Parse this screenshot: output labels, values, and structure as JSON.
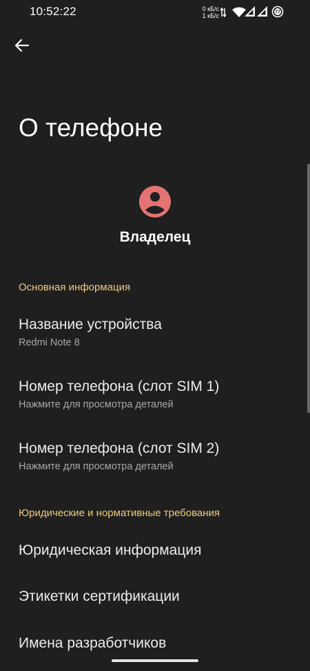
{
  "status_bar": {
    "time": "10:52:22",
    "net_speed_up": "0 кБ/с",
    "net_speed_down": "1 кБ/с",
    "battery_level": "77",
    "icons": [
      "data-transfer-icon",
      "wifi-icon",
      "signal-sim1-icon",
      "signal-sim2-icon",
      "battery-icon"
    ]
  },
  "header": {
    "back_icon": "arrow-left-icon",
    "title": "О телефоне"
  },
  "profile": {
    "avatar_icon": "account-circle-icon",
    "name": "Владелец",
    "avatar_color": "#e57373"
  },
  "sections": {
    "basic": {
      "title": "Основная информация",
      "items": [
        {
          "title": "Название устройства",
          "summary": "Redmi Note 8"
        },
        {
          "title": "Номер телефона (слот SIM 1)",
          "summary": "Нажмите для просмотра деталей"
        },
        {
          "title": "Номер телефона (слот SIM 2)",
          "summary": "Нажмите для просмотра деталей"
        }
      ]
    },
    "legal": {
      "title": "Юридические и нормативные требования",
      "items": [
        {
          "title": "Юридическая информация"
        },
        {
          "title": "Этикетки сертификации"
        },
        {
          "title": "Имена разработчиков"
        }
      ]
    }
  },
  "colors": {
    "background": "#1f1f1f",
    "accent": "#f2cb7f",
    "text_primary": "#ececec",
    "text_secondary": "#a8a8a8"
  }
}
